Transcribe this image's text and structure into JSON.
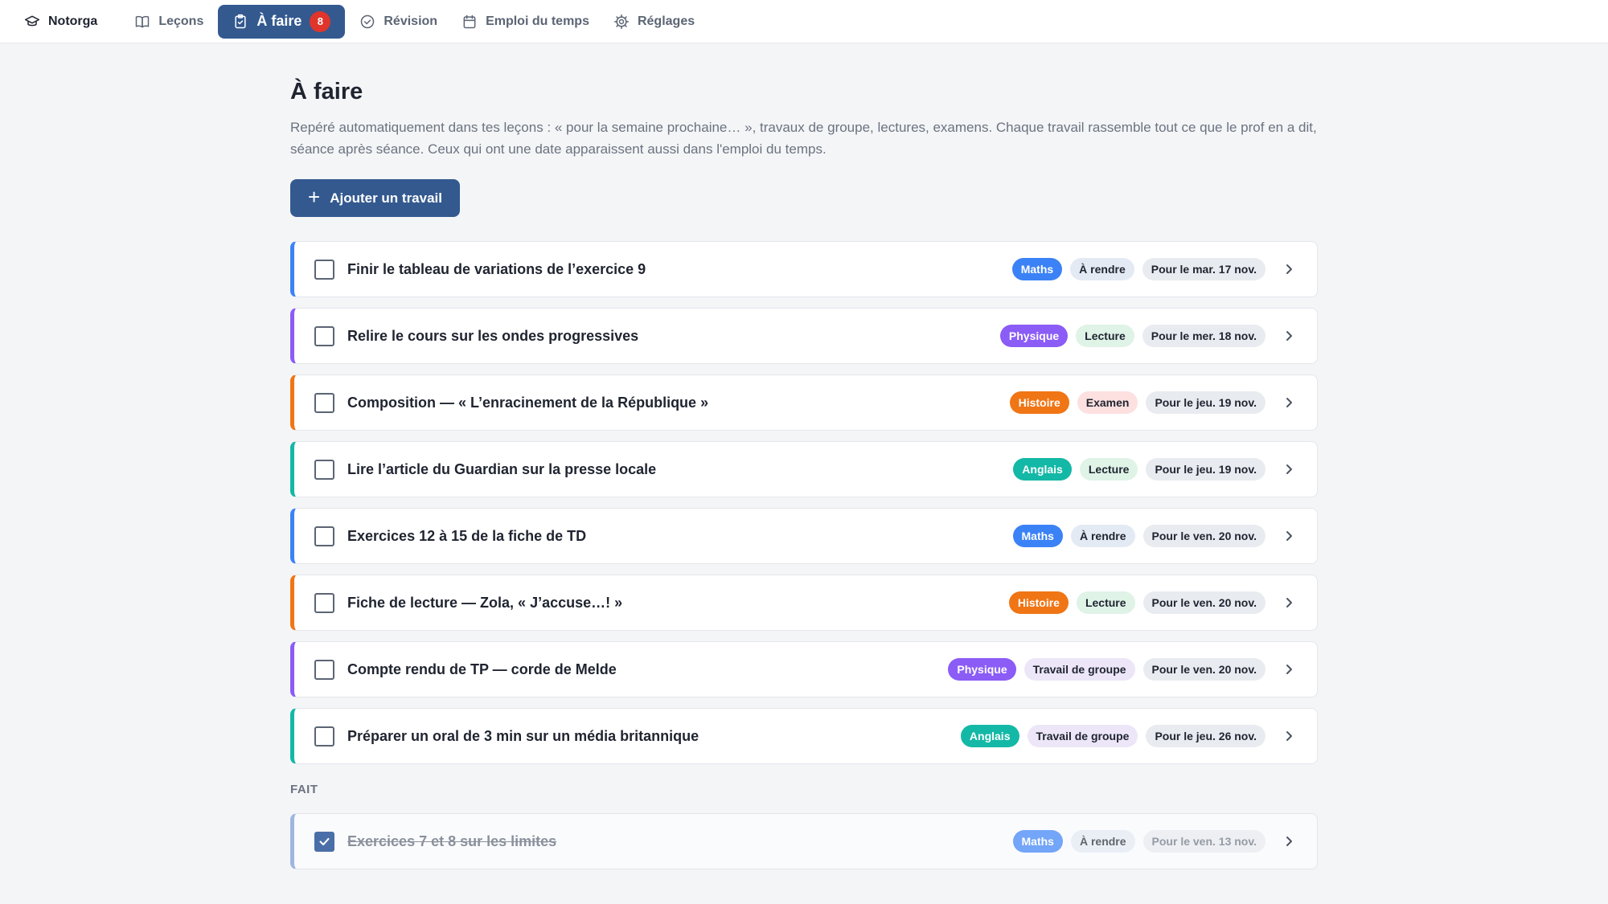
{
  "nav": {
    "brand": "Notorga",
    "items": [
      {
        "label": "Leçons",
        "icon": "book-icon"
      },
      {
        "label": "À faire",
        "icon": "clipboard-check-icon",
        "count": "8",
        "active": true
      },
      {
        "label": "Révision",
        "icon": "check-circle-icon"
      },
      {
        "label": "Emploi du temps",
        "icon": "calendar-icon"
      },
      {
        "label": "Réglages",
        "icon": "gear-icon"
      }
    ]
  },
  "page": {
    "title": "À faire",
    "intro": "Repéré automatiquement dans tes leçons : « pour la semaine prochaine… », travaux de groupe, lectures, examens. Chaque travail rassemble tout ce que le prof en a dit, séance après séance. Ceux qui ont une date apparaissent aussi dans l'emploi du temps.",
    "add_button": "Ajouter un travail"
  },
  "colors": {
    "Maths": "#3b82f6",
    "Physique": "#8b5cf6",
    "Histoire": "#f07515",
    "Anglais": "#14b8a6",
    "type_bg": {
      "À rendre": "#e4eaf4",
      "Lecture": "#dff3e7",
      "Examen": "#fde0e0",
      "Travail de groupe": "#ece6f8"
    },
    "accent": "#33598f",
    "badge": "#e0352b"
  },
  "tasks": [
    {
      "title": "Finir le tableau de variations de l’exercice 9",
      "subject": "Maths",
      "type": "À rendre",
      "due": "Pour le mar. 17 nov."
    },
    {
      "title": "Relire le cours sur les ondes progressives",
      "subject": "Physique",
      "type": "Lecture",
      "due": "Pour le mer. 18 nov."
    },
    {
      "title": "Composition — « L’enracinement de la République »",
      "subject": "Histoire",
      "type": "Examen",
      "due": "Pour le jeu. 19 nov."
    },
    {
      "title": "Lire l’article du Guardian sur la presse locale",
      "subject": "Anglais",
      "type": "Lecture",
      "due": "Pour le jeu. 19 nov."
    },
    {
      "title": "Exercices 12 à 15 de la fiche de TD",
      "subject": "Maths",
      "type": "À rendre",
      "due": "Pour le ven. 20 nov."
    },
    {
      "title": "Fiche de lecture — Zola, « J’accuse…! »",
      "subject": "Histoire",
      "type": "Lecture",
      "due": "Pour le ven. 20 nov."
    },
    {
      "title": "Compte rendu de TP — corde de Melde",
      "subject": "Physique",
      "type": "Travail de groupe",
      "due": "Pour le ven. 20 nov."
    },
    {
      "title": "Préparer un oral de 3 min sur un média britannique",
      "subject": "Anglais",
      "type": "Travail de groupe",
      "due": "Pour le jeu. 26 nov."
    }
  ],
  "done_section": {
    "label": "FAIT",
    "tasks": [
      {
        "title": "Exercices 7 et 8 sur les limites",
        "subject": "Maths",
        "type": "À rendre",
        "due": "Pour le ven. 13 nov.",
        "done": true
      }
    ]
  }
}
